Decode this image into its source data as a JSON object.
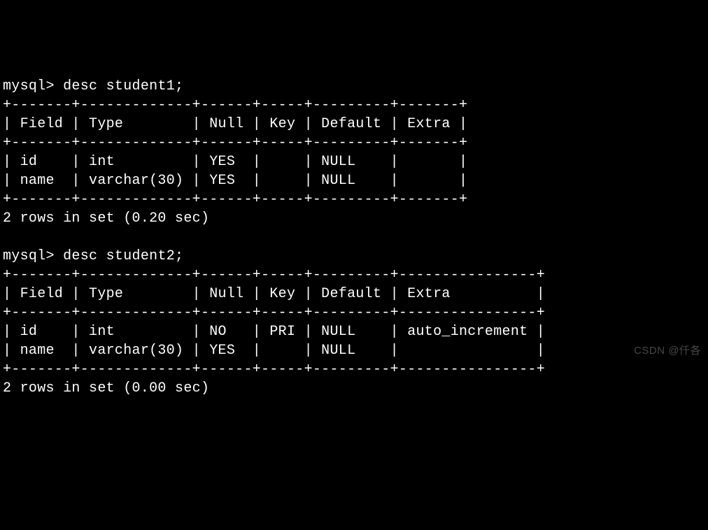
{
  "prompt": "mysql>",
  "query1": {
    "command": "desc student1;",
    "table": {
      "border_top": "+-------+-------------+------+-----+---------+-------+",
      "header": "| Field | Type        | Null | Key | Default | Extra |",
      "border_mid": "+-------+-------------+------+-----+---------+-------+",
      "rows": [
        "| id    | int         | YES  |     | NULL    |       |",
        "| name  | varchar(30) | YES  |     | NULL    |       |"
      ],
      "border_bot": "+-------+-------------+------+-----+---------+-------+"
    },
    "status": "2 rows in set (0.20 sec)"
  },
  "query2": {
    "command": "desc student2;",
    "table": {
      "border_top": "+-------+-------------+------+-----+---------+----------------+",
      "header": "| Field | Type        | Null | Key | Default | Extra          |",
      "border_mid": "+-------+-------------+------+-----+---------+----------------+",
      "rows": [
        "| id    | int         | NO   | PRI | NULL    | auto_increment |",
        "| name  | varchar(30) | YES  |     | NULL    |                |"
      ],
      "border_bot": "+-------+-------------+------+-----+---------+----------------+"
    },
    "status": "2 rows in set (0.00 sec)"
  },
  "watermark": "CSDN @仟各"
}
